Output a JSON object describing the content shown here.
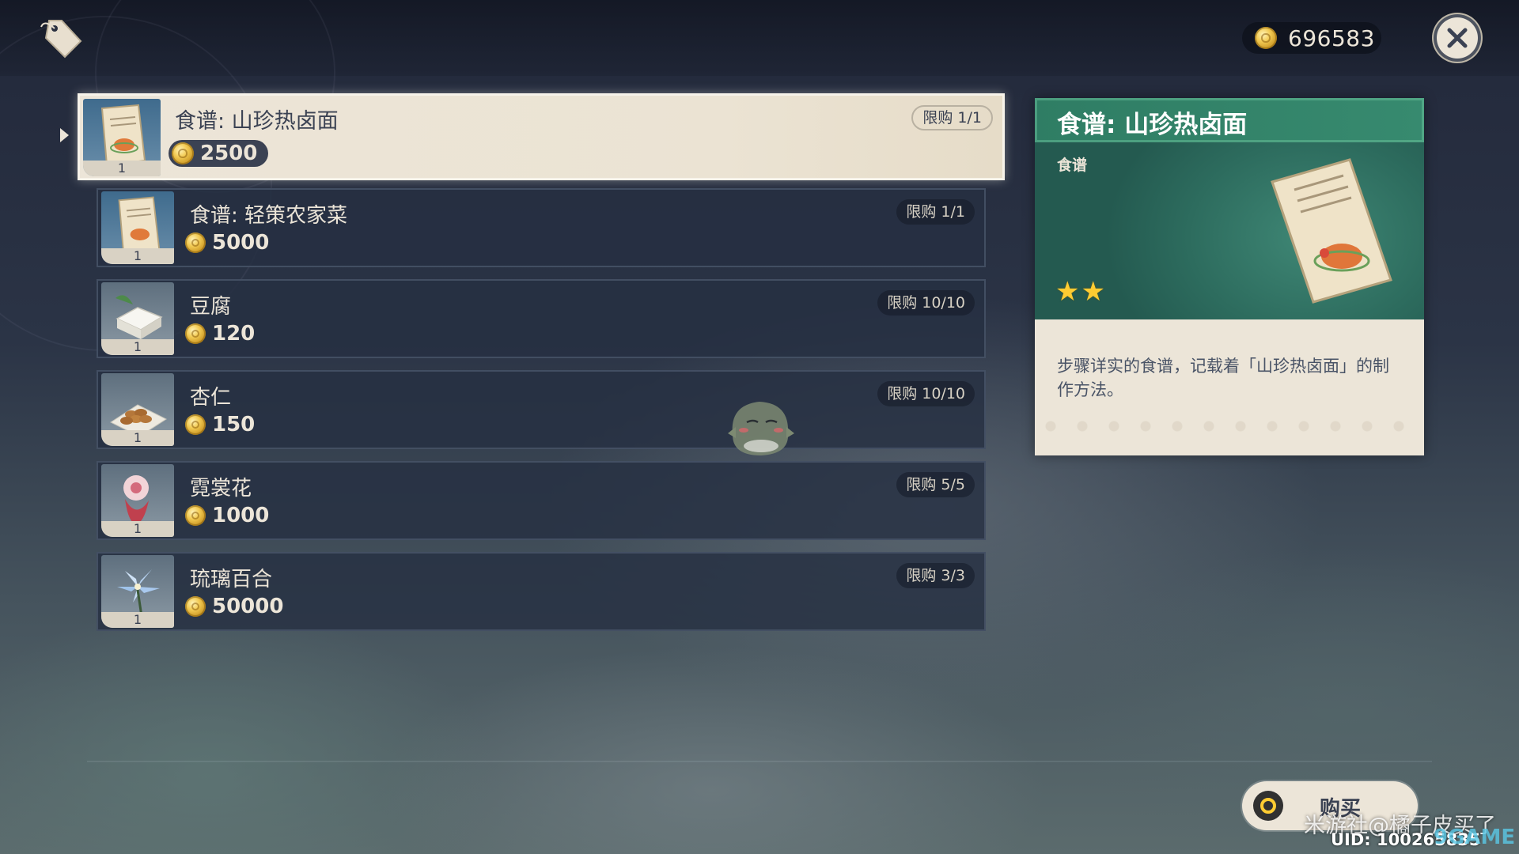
{
  "currency": {
    "amount": "696583",
    "icon": "mora-coin-icon"
  },
  "shop_icon": "price-tag-icon",
  "close_icon": "close-icon",
  "items": [
    {
      "name": "食谱: 山珍热卤面",
      "price": "2500",
      "limit": "限购 1/1",
      "count": "1",
      "icon": "recipe-scroll-icon",
      "selected": true
    },
    {
      "name": "食谱: 轻策农家菜",
      "price": "5000",
      "limit": "限购 1/1",
      "count": "1",
      "icon": "recipe-scroll-icon",
      "selected": false
    },
    {
      "name": "豆腐",
      "price": "120",
      "limit": "限购 10/10",
      "count": "1",
      "icon": "tofu-icon",
      "selected": false
    },
    {
      "name": "杏仁",
      "price": "150",
      "limit": "限购 10/10",
      "count": "1",
      "icon": "almond-icon",
      "selected": false
    },
    {
      "name": "霓裳花",
      "price": "1000",
      "limit": "限购 5/5",
      "count": "1",
      "icon": "silk-flower-icon",
      "selected": false
    },
    {
      "name": "琉璃百合",
      "price": "50000",
      "limit": "限购 3/3",
      "count": "1",
      "icon": "glaze-lily-icon",
      "selected": false
    }
  ],
  "detail": {
    "title": "食谱: 山珍热卤面",
    "type": "食谱",
    "rarity": 2,
    "description": "步骤详实的食谱，记载着「山珍热卤面」的制作方法。"
  },
  "buy_button": {
    "label": "购买",
    "icon": "confirm-circle-icon"
  },
  "uid": "UID: 100265835",
  "watermark": "米游社@橘子皮买了",
  "watermark_brand": "9GAME",
  "colors": {
    "panel_cream": "#ece5d8",
    "header_green": "#2f7d64",
    "text_dark": "#3b4253",
    "star_gold": "#ffcc32"
  }
}
